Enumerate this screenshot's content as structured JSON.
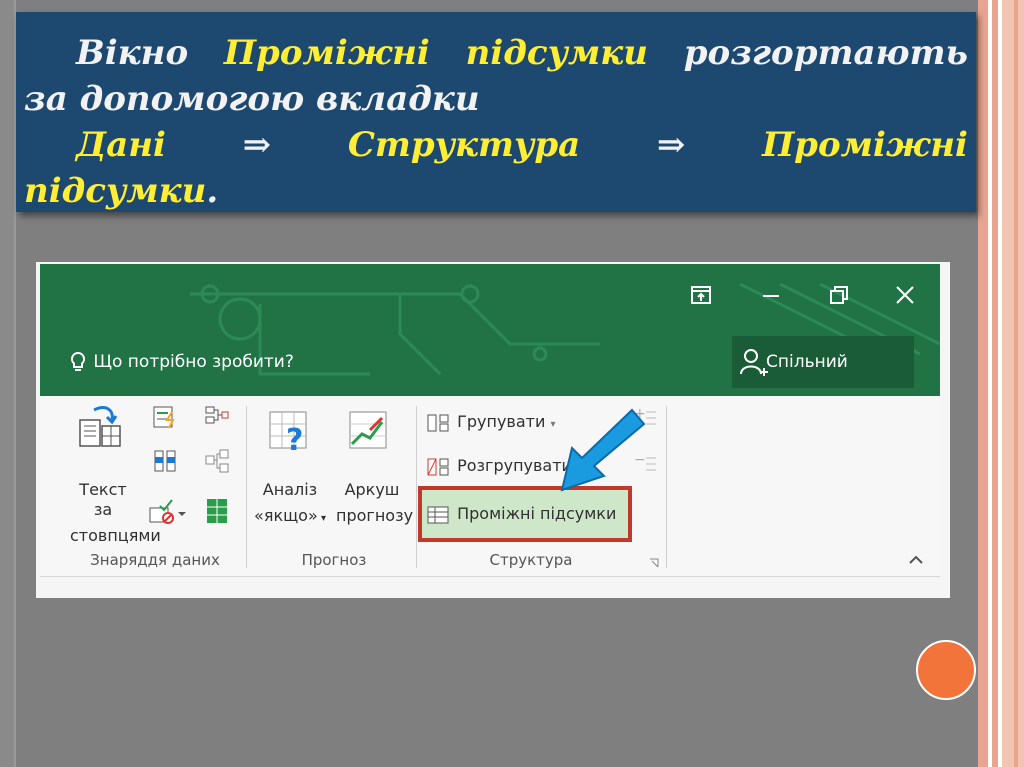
{
  "slide": {
    "line1_words": [
      "Вікно",
      "Проміжні",
      "підсумки",
      "розгортають"
    ],
    "line2": "за допомогою вкладки",
    "line3_words": [
      "Дані",
      "⇒",
      "Структура",
      "⇒",
      "Проміжні"
    ],
    "line4_word": "підсумки",
    "line4_period": ".",
    "colors": {
      "highlight": "#ffee33",
      "box": "#1d4870",
      "text": "#f2f2f2"
    }
  },
  "excel": {
    "ask_icon": "lightbulb-icon",
    "ask_text": "Що потрібно зробити?",
    "share_icon": "person-add-icon",
    "share_label": "Спільний доступ",
    "window_buttons": [
      "restore-ribbon-icon",
      "minimize-icon",
      "restore-window-icon",
      "close-icon"
    ],
    "data_tools": {
      "text_to_columns_line1": "Текст за",
      "text_to_columns_line2": "стовпцями",
      "group_label": "Знаряддя даних"
    },
    "forecast": {
      "whatif_line1": "Аналіз",
      "whatif_line2": "«якщо»",
      "forecast_line1": "Аркуш",
      "forecast_line2": "прогнозу",
      "group_label": "Прогноз"
    },
    "outline": {
      "group": "Групувати",
      "ungroup": "Розгрупувати",
      "subtotal": "Проміжні підсумки",
      "group_label": "Структура"
    },
    "colors": {
      "green": "#217346",
      "highlight_border": "#c0392b",
      "arrow": "#1a9be0"
    }
  }
}
